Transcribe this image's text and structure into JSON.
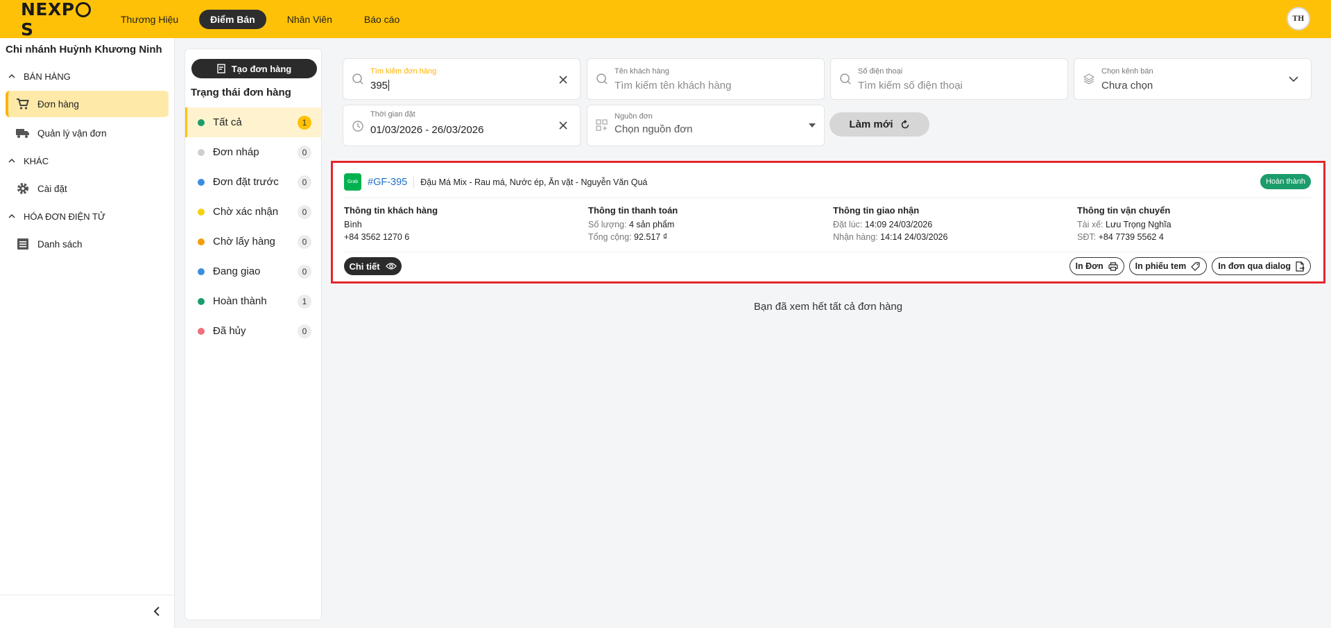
{
  "topbar": {
    "logo": "NEXPOS",
    "nav": [
      "Thương Hiệu",
      "Điểm Bán",
      "Nhân Viên",
      "Báo cáo"
    ],
    "active_nav": "Điểm Bán",
    "avatar_text": "TH"
  },
  "sidebar": {
    "branch": "Chi nhánh Huỳnh Khương Ninh",
    "sections": [
      {
        "title": "BÁN HÀNG",
        "items": [
          "Đơn hàng",
          "Quản lý vận đơn"
        ]
      },
      {
        "title": "KHÁC",
        "items": [
          "Cài đặt"
        ]
      },
      {
        "title": "HÓA ĐƠN ĐIỆN TỬ",
        "items": [
          "Danh sách"
        ]
      }
    ],
    "active_item": "Đơn hàng"
  },
  "status_panel": {
    "create_button": "Tạo đơn hàng",
    "title": "Trạng thái đơn hàng",
    "statuses": [
      {
        "label": "Tất cả",
        "count": "1",
        "color": "#1a9c6b"
      },
      {
        "label": "Đơn nháp",
        "count": "0",
        "color": "#cfcfcf"
      },
      {
        "label": "Đơn đặt trước",
        "count": "0",
        "color": "#3b8de0"
      },
      {
        "label": "Chờ xác nhận",
        "count": "0",
        "color": "#f5d10a"
      },
      {
        "label": "Chờ lấy hàng",
        "count": "0",
        "color": "#f59e0b"
      },
      {
        "label": "Đang giao",
        "count": "0",
        "color": "#3b8de0"
      },
      {
        "label": "Hoàn thành",
        "count": "1",
        "color": "#1a9c6b"
      },
      {
        "label": "Đã hủy",
        "count": "0",
        "color": "#f0707a"
      }
    ]
  },
  "filters": {
    "search_order": {
      "label": "Tìm kiếm đơn hàng",
      "value": "395"
    },
    "customer_name": {
      "label": "Tên khách hàng",
      "placeholder": "Tìm kiếm tên khách hàng"
    },
    "phone": {
      "label": "Số điện thoại",
      "placeholder": "Tìm kiếm số điện thoại"
    },
    "channel": {
      "label": "Chọn kênh bán",
      "value": "Chưa chọn"
    },
    "order_time": {
      "label": "Thời gian đặt",
      "value": "01/03/2026 - 26/03/2026"
    },
    "source": {
      "label": "Nguồn đơn",
      "placeholder": "Chọn nguồn đơn"
    },
    "refresh_button": "Làm mới"
  },
  "order": {
    "platform": "Grab",
    "id": "#GF-395",
    "store": "Đậu Má Mix - Rau má, Nước ép, Ăn vặt - Nguyễn Văn Quá",
    "status": "Hoàn thành",
    "customer": {
      "heading": "Thông tin khách hàng",
      "name": "Bình",
      "phone": "+84 3562 1270 6"
    },
    "payment": {
      "heading": "Thông tin thanh toán",
      "qty_label": "Số lượng:",
      "qty_value": "4 sản phẩm",
      "total_label": "Tổng cộng:",
      "total_value": "92.517 ₫"
    },
    "delivery": {
      "heading": "Thông tin giao nhận",
      "ordered_label": "Đặt lúc:",
      "ordered_value": "14:09 24/03/2026",
      "received_label": "Nhận hàng:",
      "received_value": "14:14 24/03/2026"
    },
    "shipping": {
      "heading": "Thông tin vận chuyển",
      "driver_label": "Tài xế:",
      "driver_value": "Lưu Trọng Nghĩa",
      "phone_label": "SĐT:",
      "phone_value": "+84 7739 5562 4"
    },
    "detail_button": "Chi tiết",
    "print_buttons": [
      "In Đơn",
      "In phiếu tem",
      "In đơn qua dialog"
    ]
  },
  "end_message": "Bạn đã xem hết tất cả đơn hàng"
}
